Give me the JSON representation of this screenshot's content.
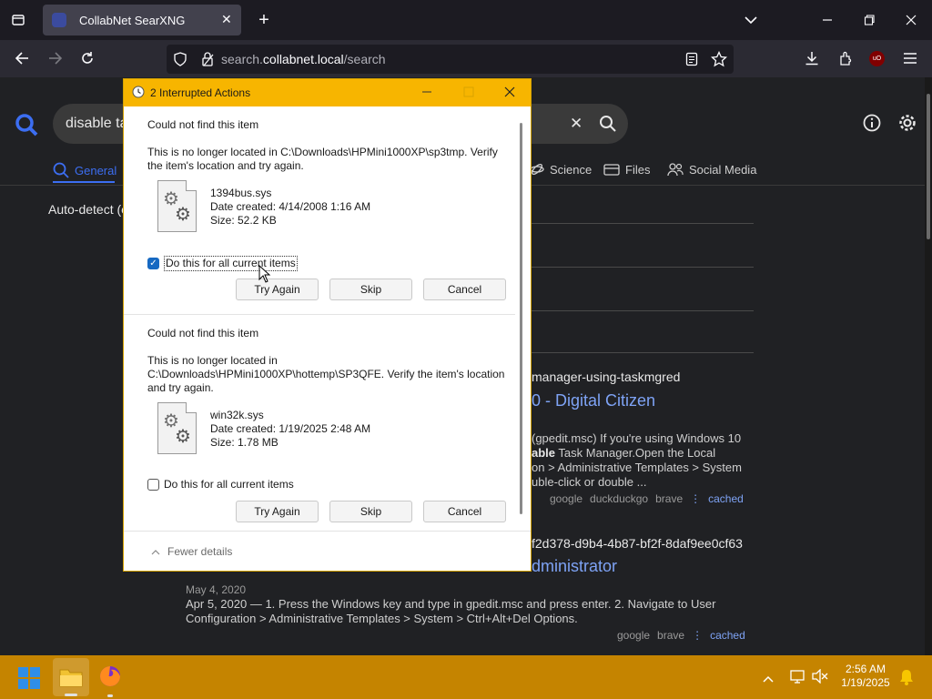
{
  "browser": {
    "tab_title": "CollabNet SearXNG",
    "url_prefix": "search.",
    "url_domain": "collabnet.local",
    "url_path": "/search"
  },
  "search": {
    "query": "disable ta",
    "categories": [
      {
        "label": "General",
        "icon": "magnifier-icon"
      },
      {
        "label": "Science",
        "icon": "science-icon"
      },
      {
        "label": "Files",
        "icon": "files-icon"
      },
      {
        "label": "Social Media",
        "icon": "people-icon"
      }
    ],
    "autodetect": "Auto-detect (e"
  },
  "results": [
    {
      "url_tail": "manager-using-taskmgred",
      "title_tail": "0 - Digital Citizen",
      "snippet_lines": [
        "(gpedit.msc) If you're using Windows 10",
        "able Task Manager.Open the Local",
        "on > Administrative Templates > System",
        "uble-click or double ..."
      ],
      "engines": [
        "google",
        "duckduckgo",
        "brave"
      ],
      "cached": "cached"
    },
    {
      "url_tail": "f2d378-d9b4-4b87-bf2f-8daf9ee0cf63",
      "title_tail": "dministrator",
      "date": "May 4, 2020",
      "snippet_lines": [
        "Apr 5, 2020 — 1. Press the Windows key and type in gpedit.msc and press enter. 2. Navigate to User",
        "Configuration > Administrative Templates > System > Ctrl+Alt+Del Options."
      ],
      "engines": [
        "google",
        "brave"
      ],
      "cached": "cached"
    }
  ],
  "dialog": {
    "title": "2 Interrupted Actions",
    "items": [
      {
        "heading": "Could not find this item",
        "message": "This is no longer located in C:\\Downloads\\HPMini1000XP\\sp3tmp. Verify the item's location and try again.",
        "file_name": "1394bus.sys",
        "date_created": "Date created: 4/14/2008 1:16 AM",
        "size": "Size: 52.2 KB",
        "checkbox_label": "Do this for all current items",
        "checkbox_checked": true,
        "try_again": "Try Again",
        "skip": "Skip",
        "cancel": "Cancel"
      },
      {
        "heading": "Could not find this item",
        "message_line1": "This is no longer located in",
        "message_line2": "C:\\Downloads\\HPMini1000XP\\hottemp\\SP3QFE. Verify the item's location",
        "message_line3": "and try again.",
        "file_name": "win32k.sys",
        "date_created": "Date created: 1/19/2025 2:48 AM",
        "size": "Size: 1.78 MB",
        "checkbox_label": "Do this for all current items",
        "checkbox_checked": false,
        "try_again": "Try Again",
        "skip": "Skip",
        "cancel": "Cancel"
      }
    ],
    "fewer_details": "Fewer details"
  },
  "taskbar": {
    "time": "2:56 AM",
    "date": "1/19/2025"
  },
  "colors": {
    "dialog_title_bar": "#f7b500",
    "taskbar": "#c58400",
    "link_blue": "#7ea3f5",
    "check_blue": "#1669c2"
  }
}
